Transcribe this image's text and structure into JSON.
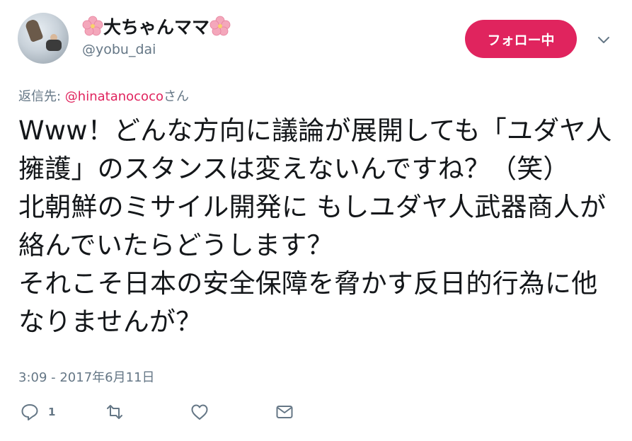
{
  "user": {
    "display_name": "大ちゃんママ",
    "handle": "@yobu_dai",
    "name_emoji": "cherry-blossom-icon"
  },
  "header": {
    "follow_label": "フォロー中"
  },
  "reply": {
    "prefix": "返信先: ",
    "mention": "@hinatanococo",
    "suffix": "さん"
  },
  "tweet": {
    "text": "Www！どんな方向に議論が展開しても「ユダヤ人擁護」のスタンスは変えないんですね？（笑）\n北朝鮮のミサイル開発に もしユダヤ人武器商人が絡んでいたらどうします？\nそれこそ日本の安全保障を脅かす反日的行為に他なりませんが？",
    "timestamp": "3:09 - 2017年6月11日"
  },
  "actions": {
    "reply_count": "1",
    "icons": [
      "reply-icon",
      "retweet-icon",
      "like-icon",
      "dm-icon"
    ]
  },
  "colors": {
    "accent": "#e0245e",
    "muted": "#657786",
    "text": "#14171a"
  }
}
